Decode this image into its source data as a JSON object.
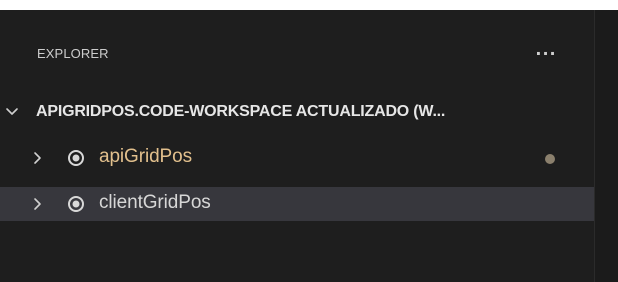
{
  "explorer": {
    "title": "EXPLORER",
    "more_actions_label": "···"
  },
  "workspace": {
    "title": "APIGRIDPOS.CODE-WORKSPACE ACTUALIZADO (W...",
    "expanded": true
  },
  "folders": [
    {
      "label": "apiGridPos",
      "icon": "target-circle-icon",
      "chevron": "chevron-right-icon",
      "modified": true,
      "selected": false
    },
    {
      "label": "clientGridPos",
      "icon": "target-circle-icon",
      "chevron": "chevron-right-icon",
      "modified": false,
      "selected": true
    }
  ],
  "colors": {
    "background": "#1e1e1e",
    "selected_row": "#37373d",
    "modified_text": "#e2c08d",
    "modified_dot": "#8b806d"
  }
}
